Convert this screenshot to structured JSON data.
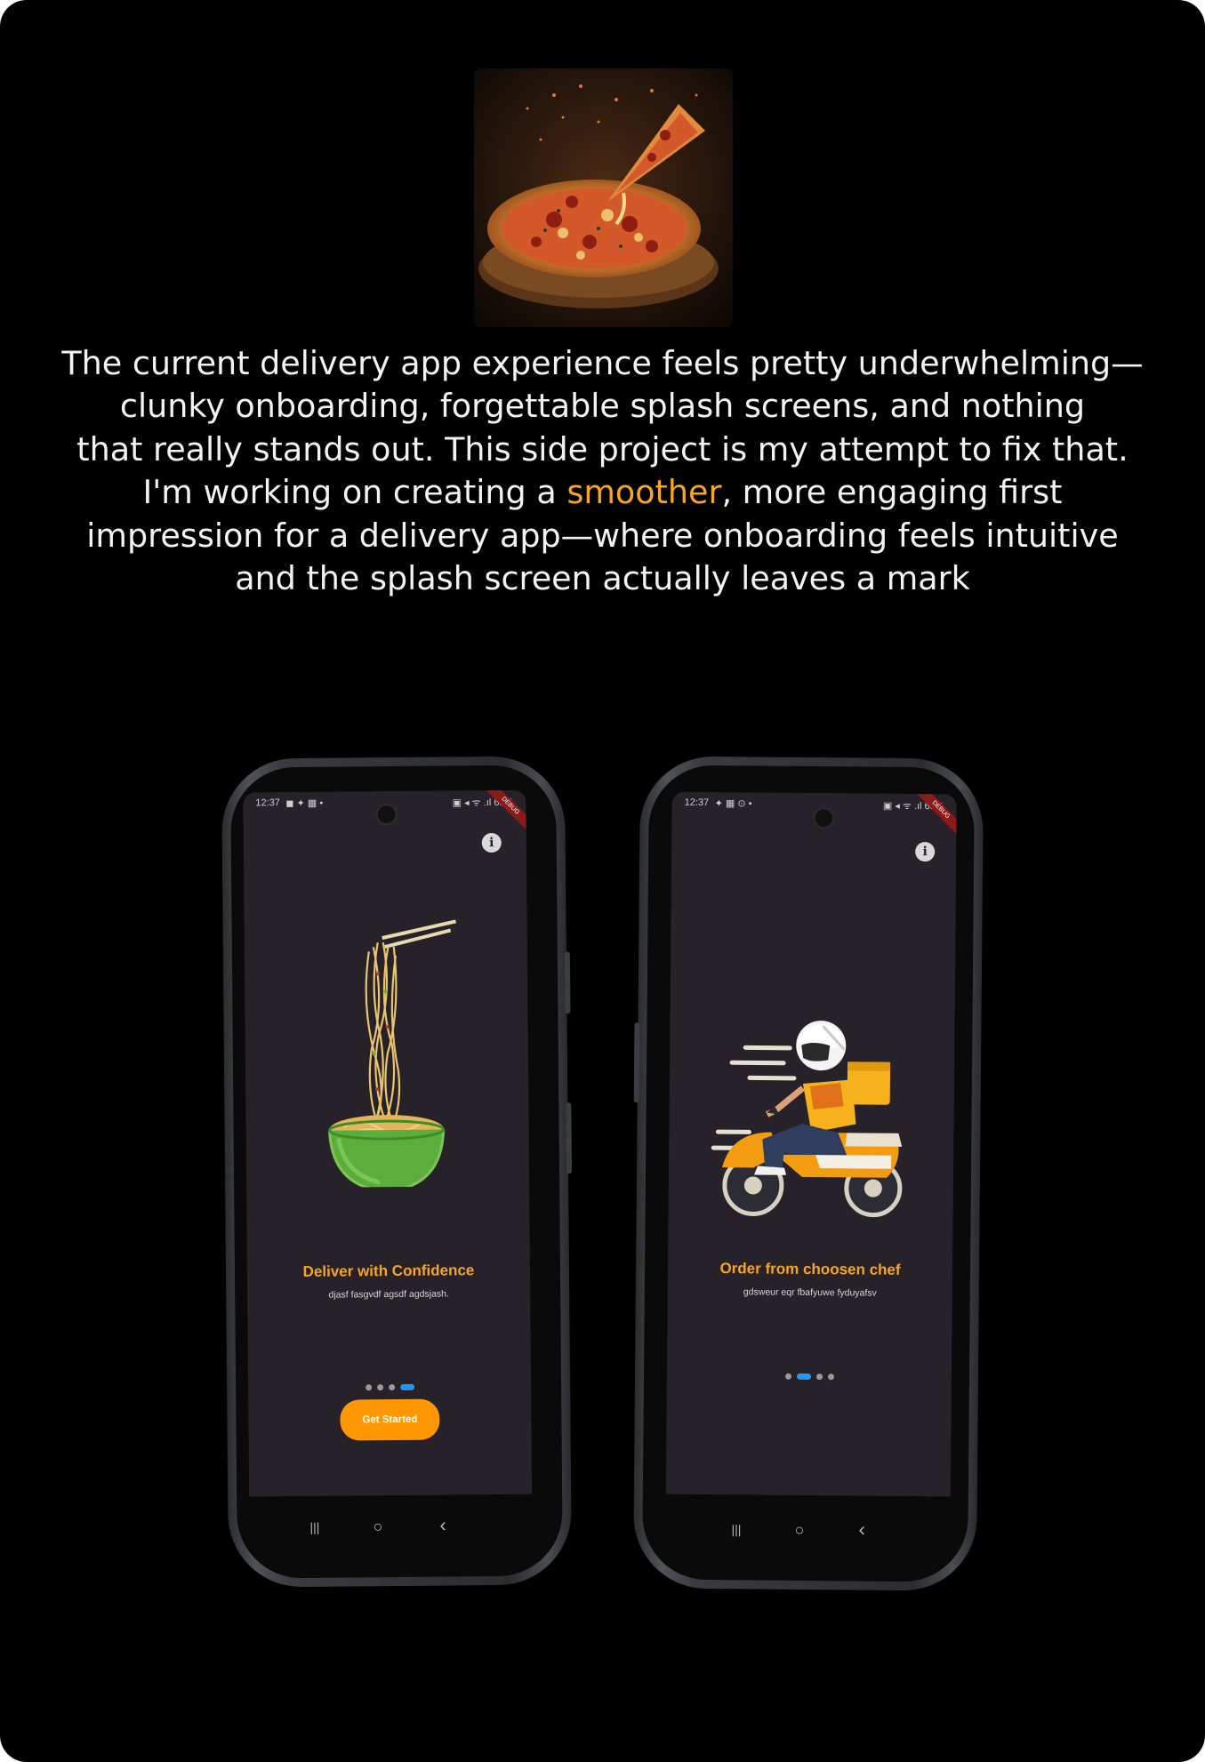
{
  "hero": {
    "image": "pizza-photo"
  },
  "intro": {
    "lines": [
      "The current delivery app experience feels pretty underwhelming—",
      "clunky onboarding, forgettable splash screens, and nothing",
      "that really stands out. This side project is my attempt to fix that."
    ],
    "line4_before": "I'm working on creating a ",
    "line4_highlight": "smoother",
    "line4_after": ", more engaging first",
    "line5": "impression for a delivery app—where onboarding feels intuitive",
    "line6": "and the splash screen actually leaves a mark"
  },
  "colors": {
    "accent": "#f5a623",
    "page_bg": "#000000",
    "screen_bg": "#27222a",
    "cta_bg": "#ff9800",
    "dot_active": "#2196f3"
  },
  "phones": [
    {
      "status_time": "12:37",
      "status_icons": "◼ ✦ ▦ •",
      "status_right": "▣ ◂ ᯤ .ıl 65%",
      "illustration": "noodle-bowl-illustration",
      "title": "Deliver with Confidence",
      "subtitle": "djasf fasgvdf agsdf agdsjash.",
      "dots_active_index": 3,
      "dots_count": 4,
      "cta_label": "Get Started",
      "nav": [
        "|||",
        "○",
        "‹"
      ]
    },
    {
      "status_time": "12:37",
      "status_icons": "✦ ▦ ⊙ •",
      "status_right": "▣ ◂ ᯤ .ıl 65%",
      "illustration": "delivery-rider-illustration",
      "title": "Order from choosen chef",
      "subtitle": "gdsweur eqr fbafyuwe fyduyafsv",
      "dots_active_index": 1,
      "dots_count": 4,
      "nav": [
        "|||",
        "○",
        "‹"
      ]
    }
  ]
}
